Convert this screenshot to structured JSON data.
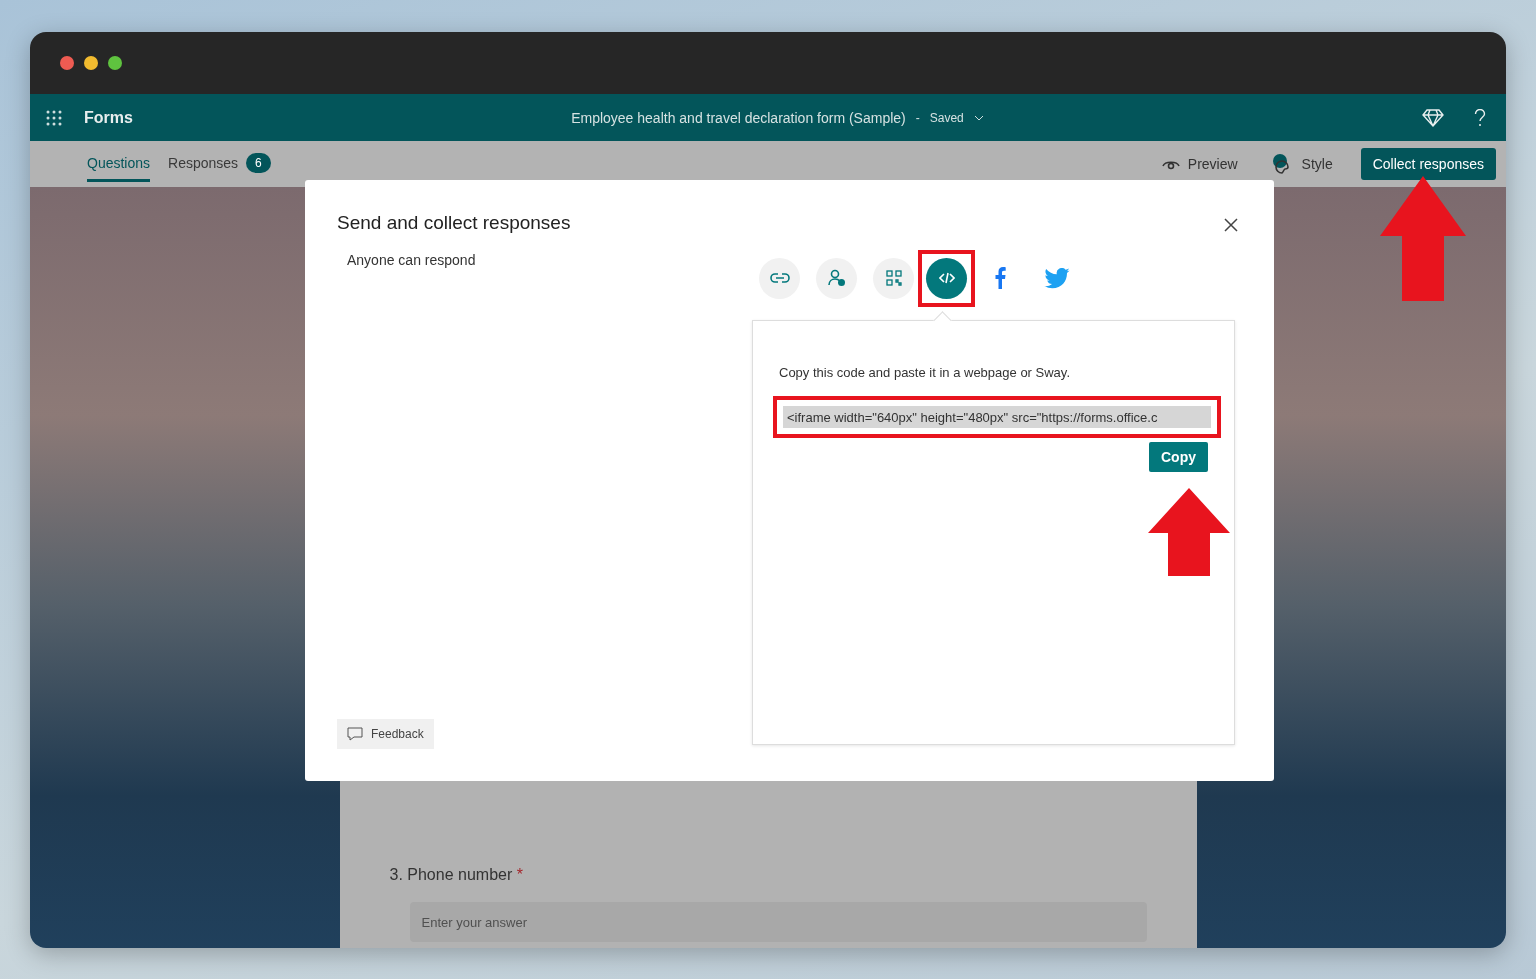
{
  "header": {
    "app_name": "Forms",
    "form_title": "Employee health and travel declaration form (Sample)",
    "separator": "-",
    "save_status": "Saved"
  },
  "tabs": [
    {
      "label": "Questions",
      "selected": true
    },
    {
      "label": "Responses",
      "selected": false,
      "badge": "6"
    }
  ],
  "actions": [
    {
      "kind": "preview",
      "label": "Preview"
    },
    {
      "kind": "style",
      "label": "Style"
    },
    {
      "kind": "primary",
      "label": "Collect responses"
    }
  ],
  "dialog": {
    "title": "Send and collect responses",
    "audience": "Anyone can respond",
    "share_options": [
      {
        "kind": "link",
        "selected": false
      },
      {
        "kind": "invite",
        "selected": false
      },
      {
        "kind": "qr",
        "selected": false
      },
      {
        "kind": "embed",
        "selected": true
      },
      {
        "kind": "facebook",
        "selected": false
      },
      {
        "kind": "twitter",
        "selected": false
      }
    ],
    "instruction": "Copy this code and paste it in a webpage or Sway.",
    "embed_code": "<iframe width=\"640px\" height=\"480px\" src=\"https://forms.office.c",
    "copy_button": "Copy",
    "feedback": "Feedback"
  },
  "question": {
    "number": "3.",
    "title": "Phone number",
    "required_mark": "*",
    "placeholder": "Enter your answer"
  }
}
